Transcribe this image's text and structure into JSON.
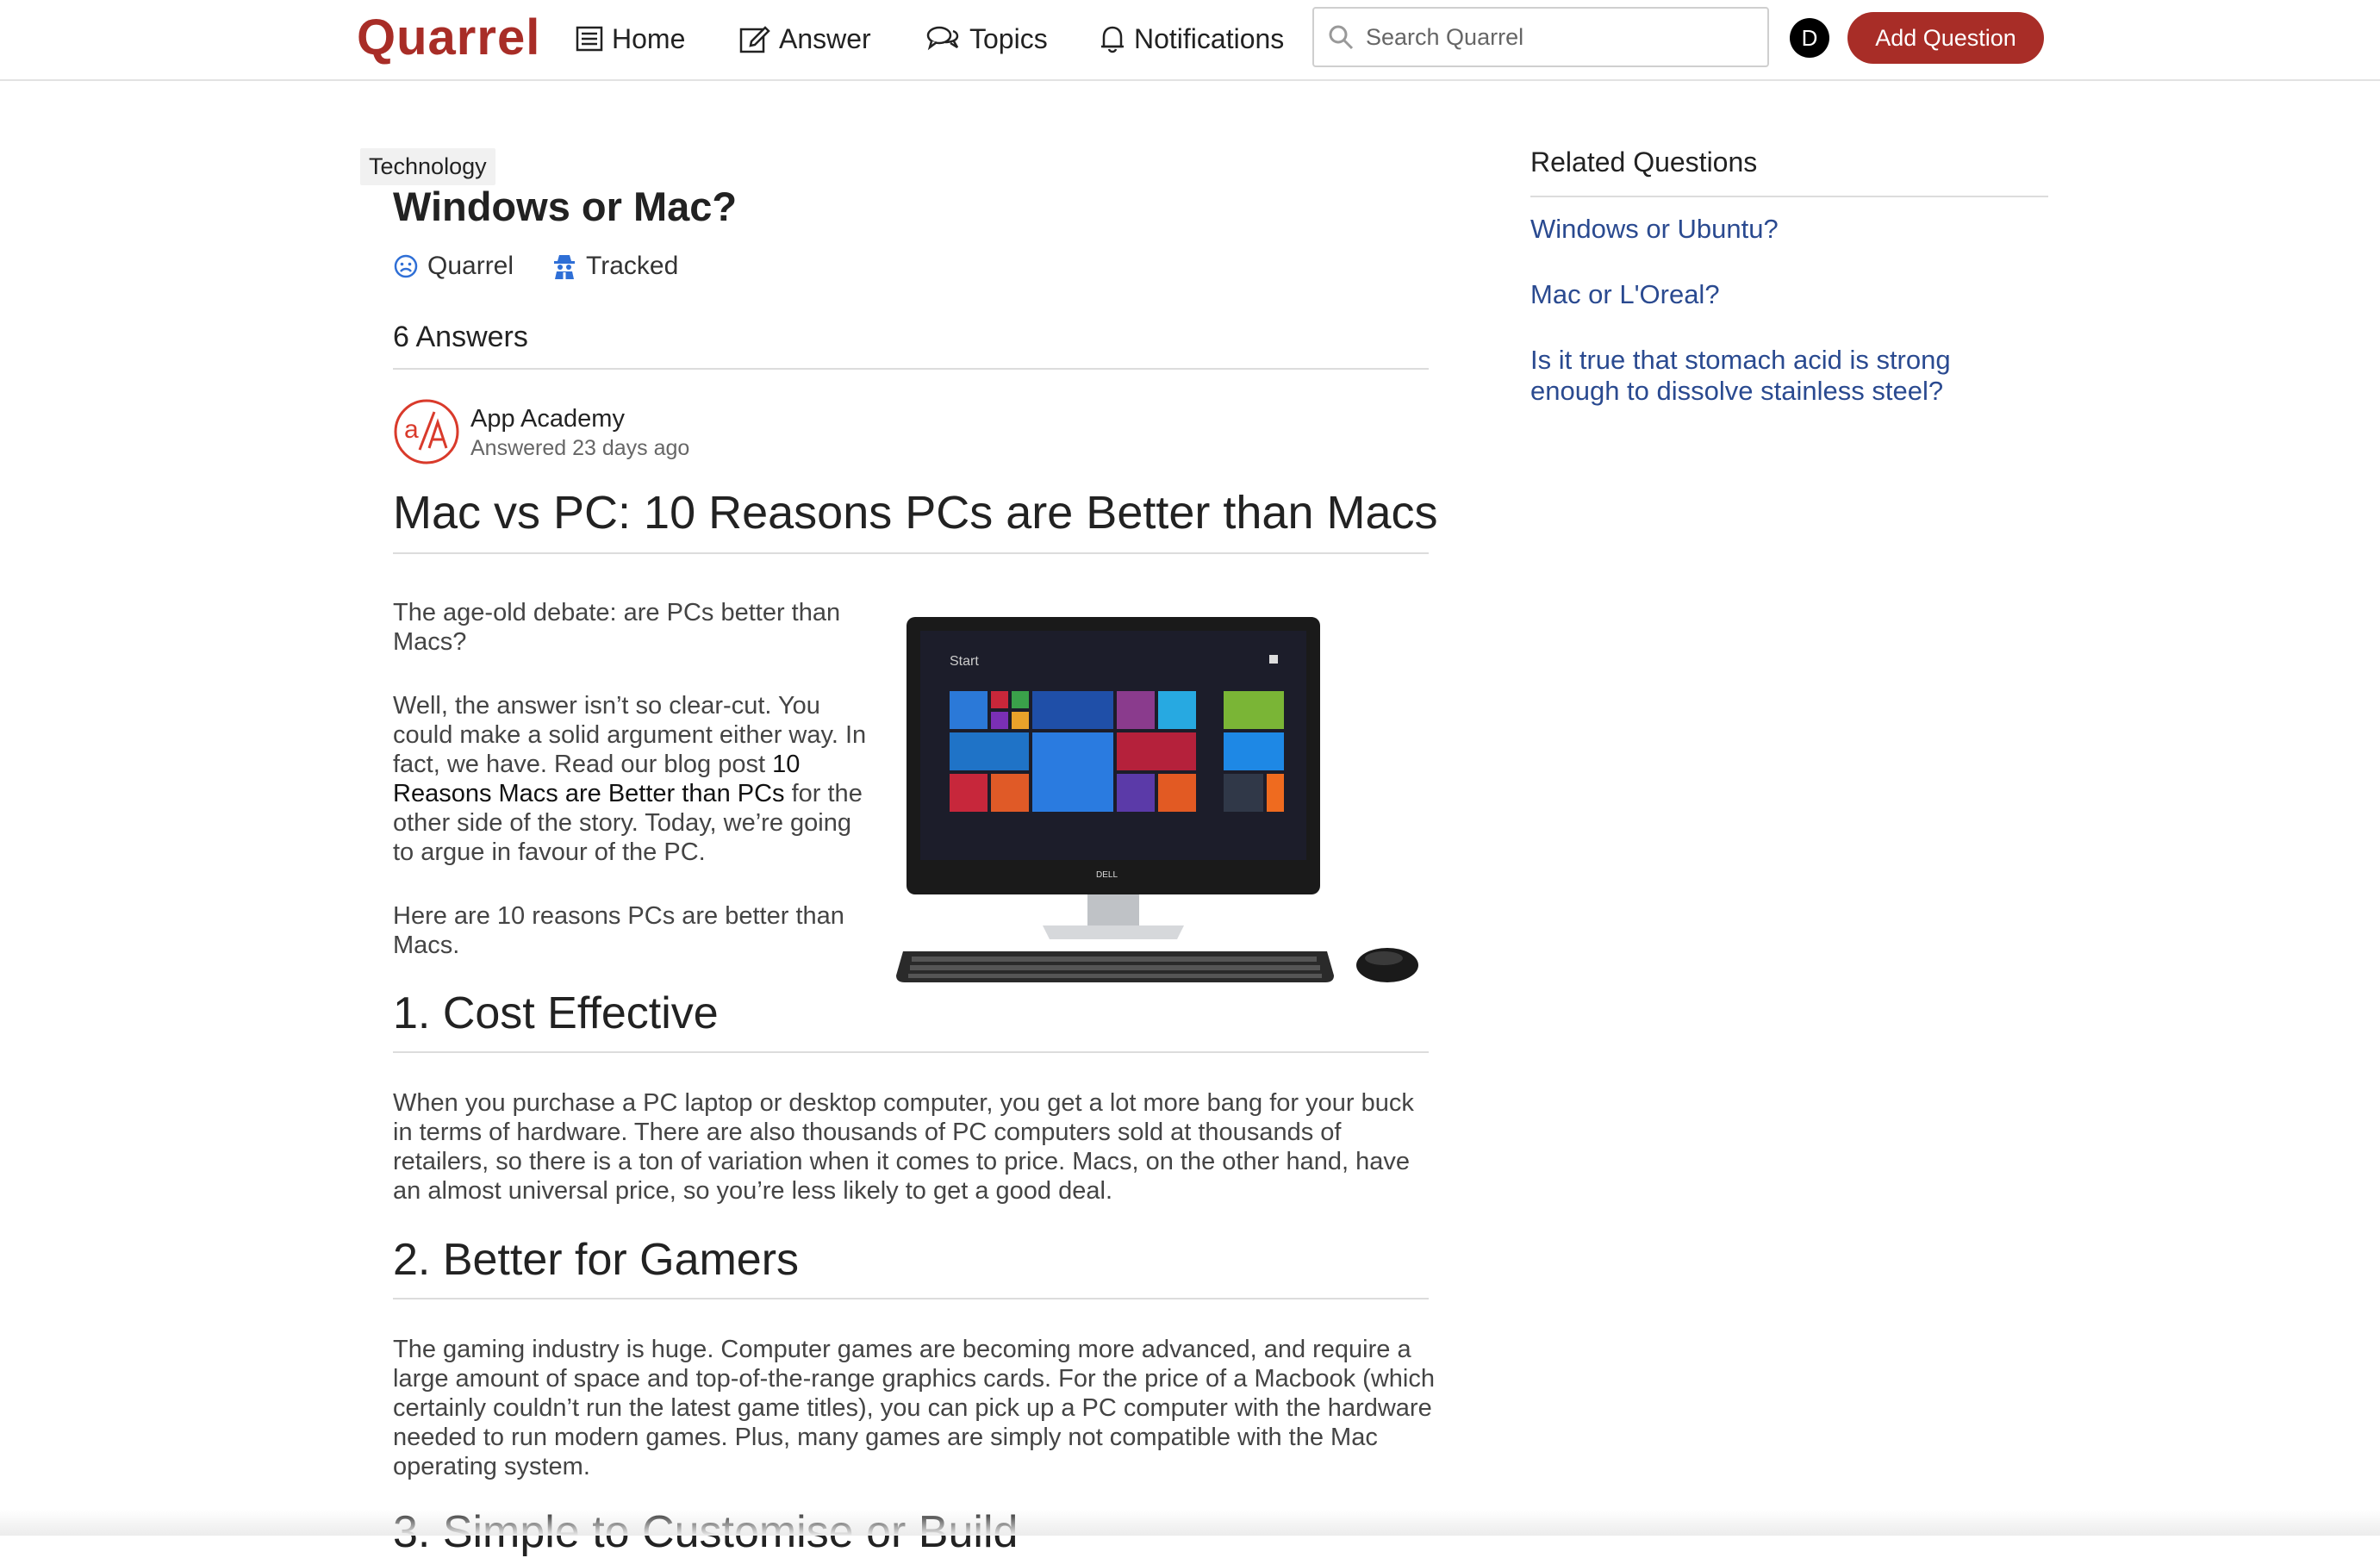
{
  "nav": {
    "logo": "Quarrel",
    "home": "Home",
    "answer": "Answer",
    "topics": "Topics",
    "notifications": "Notifications",
    "search_placeholder": "Search Quarrel",
    "avatar_initial": "D",
    "add_question": "Add Question"
  },
  "question": {
    "topic": "Technology",
    "title": "Windows or Mac?",
    "meta_quarrel": "Quarrel",
    "meta_tracked": "Tracked",
    "answers_count": "6 Answers"
  },
  "answer": {
    "author": "App Academy",
    "answered": "Answered 23 days ago",
    "heading": "Mac vs PC: 10 Reasons PCs are Better than Macs",
    "intro_1": "The age-old debate: are PCs better than Macs?",
    "intro_2_a": "Well, the answer isn’t so clear-cut. You could make a solid argument either way. In fact, we have. Read our blog post ",
    "intro_2_link": "10 Reasons Macs are Better than PCs",
    "intro_2_b": " for the other side of the story. Today, we’re going to argue in favour of the PC.",
    "intro_3": "Here are 10 reasons PCs are better than Macs.",
    "sections": [
      {
        "heading": "1. Cost Effective",
        "body": "When you purchase a PC laptop or desktop computer, you get a lot more bang for your buck in terms of hardware. There are also thousands of PC computers sold at thousands of retailers, so there is a ton of variation when it comes to price. Macs, on the other hand, have an almost universal price, so you’re less likely to get a good deal."
      },
      {
        "heading": "2. Better for Gamers",
        "body": "The gaming industry is huge. Computer games are becoming more advanced, and require a large amount of space and top-of-the-range graphics cards. For the price of a Macbook (which certainly couldn’t run the latest game titles), you can pick up a PC computer with the hardware needed to run modern games. Plus, many games are simply not compatible with the Mac operating system."
      },
      {
        "heading": "3. Simple to Customise or Build"
      }
    ],
    "screen": {
      "start_label": "Start",
      "brand": "DELL"
    }
  },
  "sidebar": {
    "title": "Related Questions",
    "links": [
      "Windows or Ubuntu?",
      "Mac or L'Oreal?",
      "Is it true that stomach acid is strong enough to dissolve stainless steel?"
    ]
  },
  "colors": {
    "brand": "#a82d27",
    "link": "#2a4a90",
    "meta_icon": "#2f6fd6"
  }
}
